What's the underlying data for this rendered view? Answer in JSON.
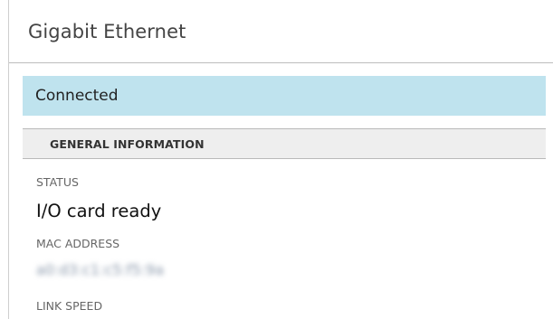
{
  "header": {
    "title": "Gigabit Ethernet"
  },
  "status_banner": {
    "text": "Connected",
    "color": "#bfe3ee"
  },
  "section": {
    "title": "GENERAL INFORMATION"
  },
  "fields": {
    "status": {
      "label": "STATUS",
      "value": "I/O card ready"
    },
    "mac_address": {
      "label": "MAC ADDRESS",
      "value": "a0:d3:c1:c5:f5:9a"
    },
    "link_speed": {
      "label": "LINK SPEED"
    }
  }
}
